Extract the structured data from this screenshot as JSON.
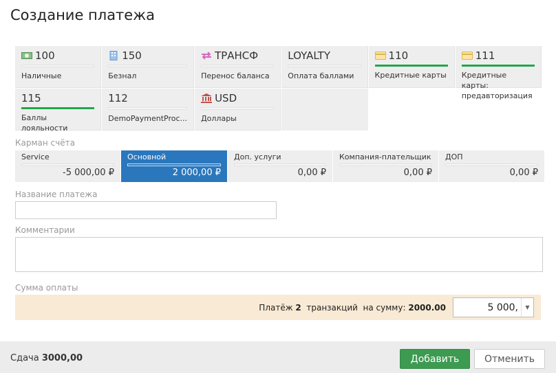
{
  "title": "Создание платежа",
  "methods": [
    {
      "code": "100",
      "label": "Наличные",
      "icon": "cash-icon",
      "active": false
    },
    {
      "code": "150",
      "label": "Безнал",
      "icon": "building-icon",
      "active": false
    },
    {
      "code": "ТРАНСФ",
      "label": "Перенос баланса",
      "icon": "transfer-icon",
      "active": false
    },
    {
      "code": "LOYALTY",
      "label": "Оплата баллами",
      "icon": "",
      "active": false
    },
    {
      "code": "110",
      "label": "Кредитные карты",
      "icon": "credit-card-icon",
      "active": true
    },
    {
      "code": "111",
      "label": "Кредитные карты: предавторизация",
      "icon": "credit-card-icon",
      "active": true
    },
    {
      "code": "115",
      "label": "Баллы лояльности",
      "icon": "",
      "active": true
    },
    {
      "code": "112",
      "label": "DemoPaymentProc...",
      "icon": "",
      "active": false
    },
    {
      "code": "USD",
      "label": "Доллары",
      "icon": "bank-icon",
      "active": false
    }
  ],
  "pocket_label": "Карман счёта",
  "pockets": [
    {
      "name": "Service",
      "value": "-5 000,00 ₽"
    },
    {
      "name": "Основной",
      "value": "2 000,00 ₽",
      "active": true
    },
    {
      "name": "Доп. услуги",
      "value": "0,00 ₽"
    },
    {
      "name": "Компания-плательщик",
      "value": "0,00 ₽"
    },
    {
      "name": "ДОП",
      "value": "0,00 ₽"
    }
  ],
  "payment_name_label": "Название платежа",
  "payment_name_value": "",
  "comments_label": "Комментарии",
  "comments_value": "",
  "sum_label": "Сумма оплаты",
  "summary": {
    "prefix": "Платёж",
    "count": "2",
    "mid": "транзакций  на сумму:",
    "total": "2000.00"
  },
  "amount": "5 000,",
  "footer": {
    "change_label": "Сдача",
    "change_value": "3000,00",
    "add": "Добавить",
    "cancel": "Отменить"
  }
}
